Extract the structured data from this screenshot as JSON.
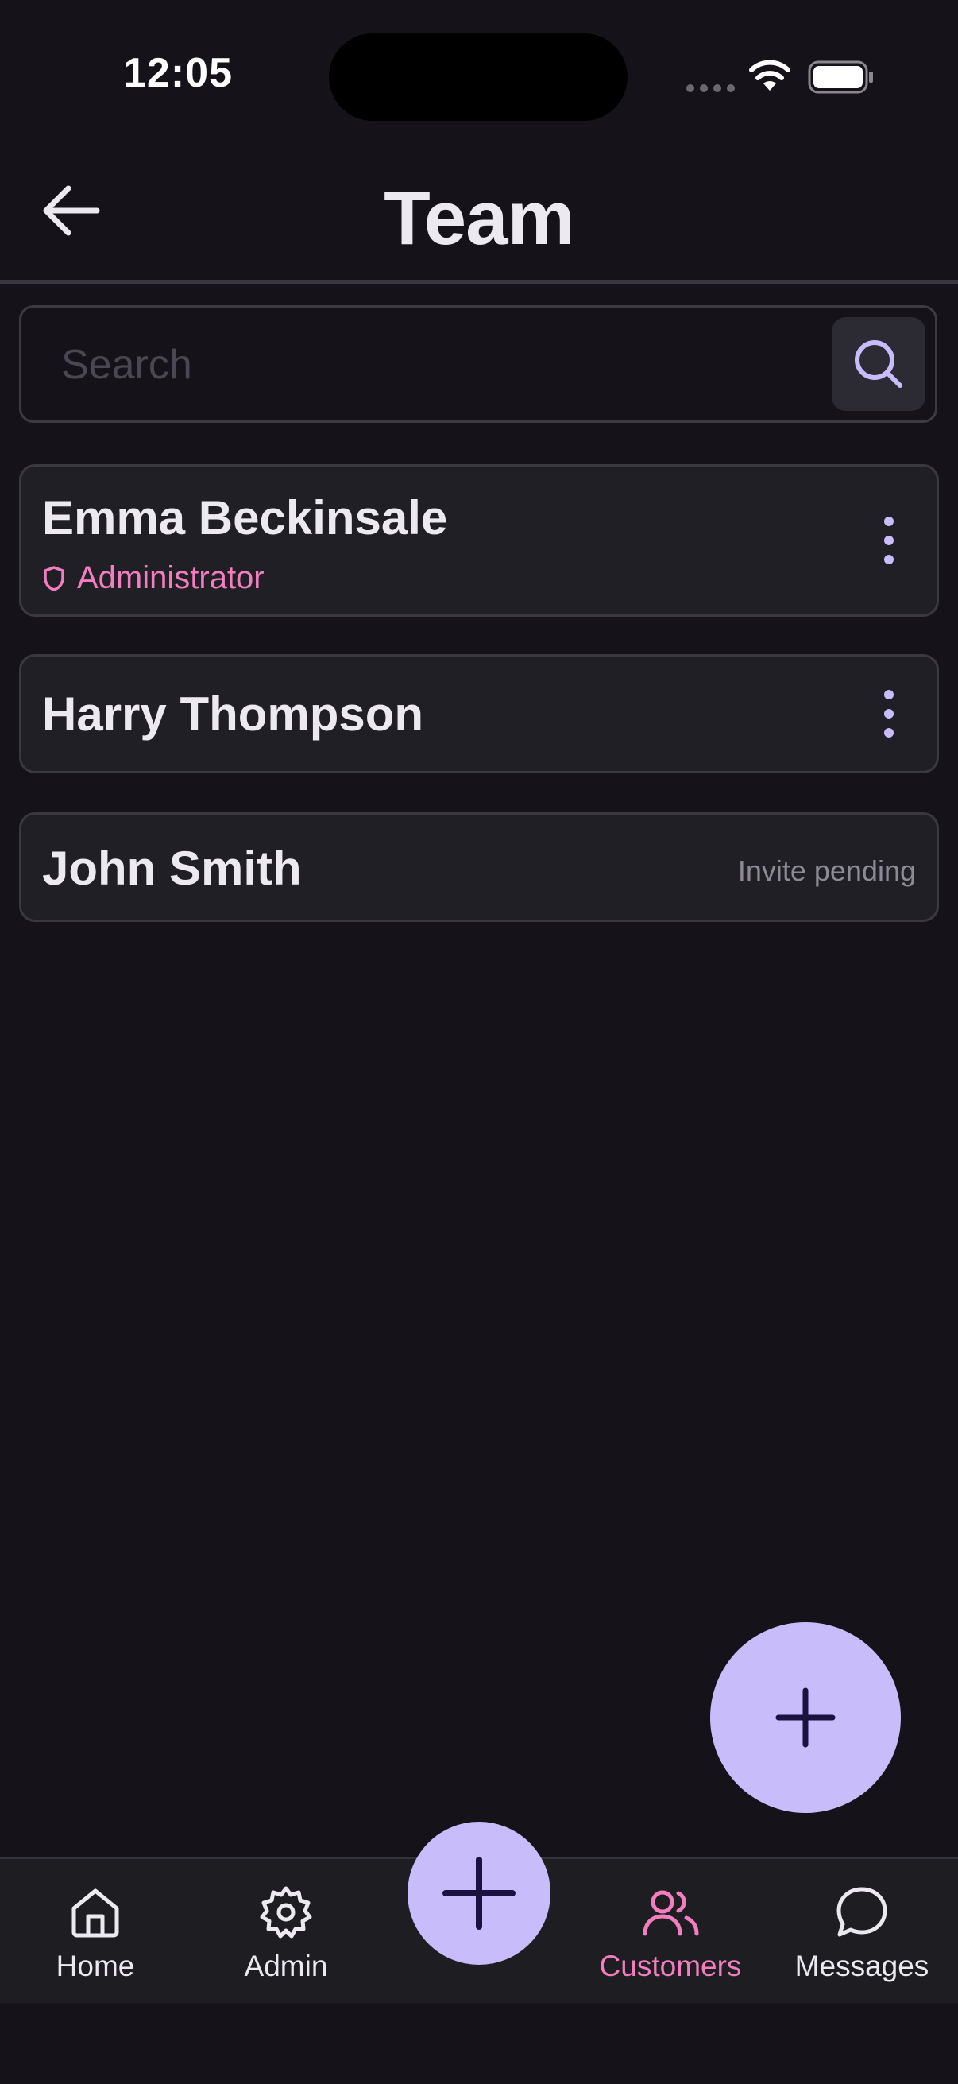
{
  "status_bar": {
    "time": "12:05"
  },
  "header": {
    "title": "Team",
    "back_icon": "arrow-left-icon"
  },
  "search": {
    "placeholder": "Search",
    "value": "",
    "button_icon": "search-icon"
  },
  "members": [
    {
      "name": "Emma Beckinsale",
      "role": "Administrator",
      "role_icon": "shield-icon",
      "action_icon": "more-vertical-icon"
    },
    {
      "name": "Harry Thompson",
      "action_icon": "more-vertical-icon"
    },
    {
      "name": "John Smith",
      "status": "Invite pending"
    }
  ],
  "fab": {
    "icon": "plus-icon"
  },
  "bottom_nav": {
    "items": [
      {
        "label": "Home",
        "icon": "home-icon",
        "active": false
      },
      {
        "label": "Admin",
        "icon": "gear-icon",
        "active": false
      },
      {
        "label": "Customers",
        "icon": "users-icon",
        "active": true
      },
      {
        "label": "Messages",
        "icon": "chat-bubble-icon",
        "active": false
      }
    ],
    "center_button_icon": "plus-icon"
  },
  "colors": {
    "background": "#151319",
    "card": "#201F25",
    "accent_lavender": "#C8BCFB",
    "accent_pink": "#F27EC0",
    "text_primary": "#ECE9F1",
    "text_muted": "#8E8A95"
  }
}
